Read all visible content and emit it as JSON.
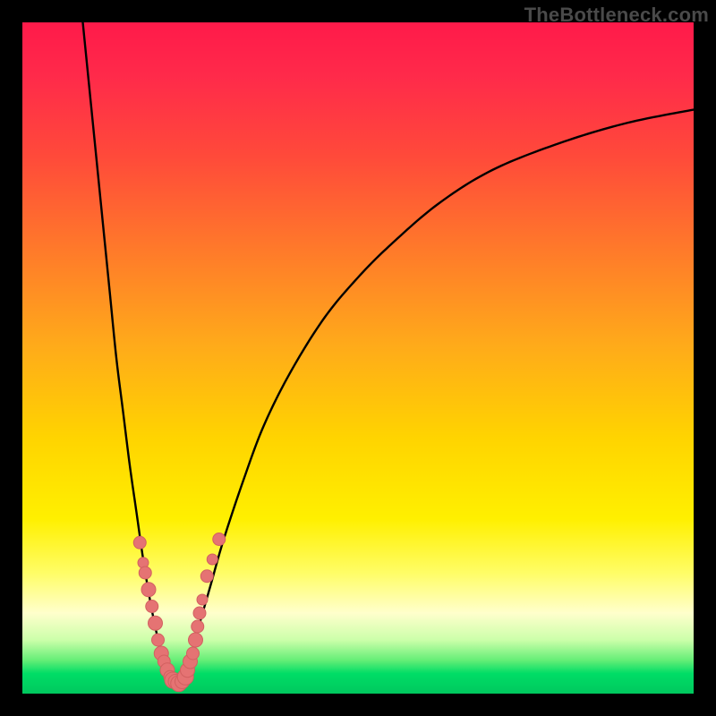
{
  "watermark": "TheBottleneck.com",
  "colors": {
    "frame": "#000000",
    "curve": "#000000",
    "dot_fill": "#e57373",
    "dot_stroke": "#d26060",
    "gradient_stops": [
      "#ff1a4a",
      "#ff2a4a",
      "#ff4a3a",
      "#ff7a2a",
      "#ffaa1a",
      "#ffd400",
      "#fff000",
      "#fffd66",
      "#ffffcc",
      "#ccffaa",
      "#66ee77",
      "#00dd66",
      "#00c85e"
    ]
  },
  "chart_data": {
    "type": "line",
    "title": "",
    "xlabel": "",
    "ylabel": "",
    "xlim": [
      0,
      100
    ],
    "ylim": [
      0,
      100
    ],
    "grid": false,
    "legend": false,
    "note": "x is a normalized horizontal coordinate 0–100; y is a normalized vertical value 0–100 where 0 is the baseline (green) and 100 is the top (red). Values estimated from pixel positions of the plotted curves.",
    "series": [
      {
        "name": "left_branch",
        "x": [
          9,
          10,
          11,
          12,
          13,
          14,
          15,
          16,
          17,
          18,
          19,
          20,
          21,
          22
        ],
        "values": [
          100,
          90,
          80,
          70,
          60,
          50,
          42,
          34,
          27,
          20,
          14,
          9,
          5,
          2
        ]
      },
      {
        "name": "right_branch",
        "x": [
          24,
          25,
          26,
          28,
          30,
          33,
          36,
          40,
          45,
          50,
          55,
          62,
          70,
          80,
          90,
          100
        ],
        "values": [
          2,
          5,
          9,
          16,
          23,
          32,
          40,
          48,
          56,
          62,
          67,
          73,
          78,
          82,
          85,
          87
        ]
      }
    ],
    "points_overlay": {
      "name": "marker_cluster",
      "note": "Pink circular markers clustered near the curve minimum; x,y in same 0–100 space as series.",
      "x": [
        17.5,
        18.0,
        18.3,
        18.8,
        19.3,
        19.8,
        20.2,
        20.7,
        21.1,
        21.6,
        22.0,
        22.4,
        22.8,
        23.3,
        23.8,
        24.3,
        24.6,
        25.0,
        25.4,
        25.8,
        26.1,
        26.4,
        26.8,
        27.5,
        28.3,
        29.3
      ],
      "values": [
        22.5,
        19.5,
        18.0,
        15.5,
        13.0,
        10.5,
        8.0,
        6.0,
        4.8,
        3.5,
        2.5,
        2.0,
        1.8,
        1.5,
        1.8,
        2.5,
        3.5,
        4.8,
        6.0,
        8.0,
        10.0,
        12.0,
        14.0,
        17.5,
        20.0,
        23.0
      ],
      "r": [
        7,
        6,
        7,
        8,
        7,
        8,
        7,
        8,
        7,
        8,
        7,
        9,
        8,
        9,
        8,
        9,
        8,
        8,
        7,
        8,
        7,
        7,
        6,
        7,
        6,
        7
      ]
    }
  }
}
